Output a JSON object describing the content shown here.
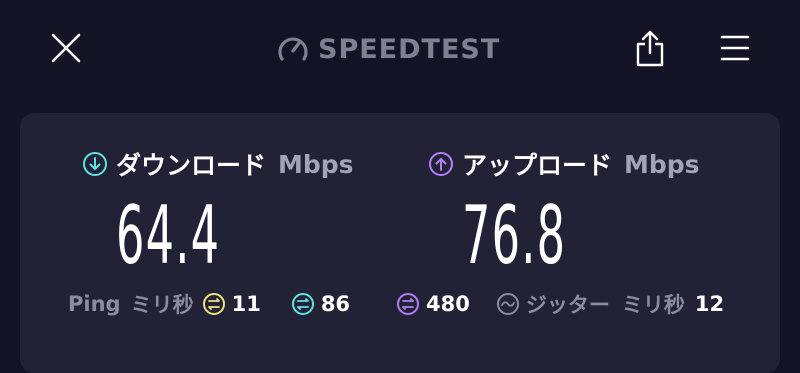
{
  "header": {
    "logo_text": "SPEEDTEST",
    "close_icon": "close-icon",
    "share_icon": "share-icon",
    "menu_icon": "menu-icon"
  },
  "download": {
    "label": "ダウンロード",
    "unit": "Mbps",
    "value": "64.4",
    "icon": "download-arrow-icon",
    "color": "#5fe3df"
  },
  "upload": {
    "label": "アップロード",
    "unit": "Mbps",
    "value": "76.8",
    "icon": "upload-arrow-icon",
    "color": "#b57ef8"
  },
  "latency": {
    "ping_label": "Ping",
    "ping_unit": "ミリ秒",
    "idle_value": "11",
    "idle_color": "#f4e07c",
    "download_value": "86",
    "download_color": "#5fe3df",
    "upload_value": "480",
    "upload_color": "#b57ef8",
    "jitter_label": "ジッター",
    "jitter_unit": "ミリ秒",
    "jitter_value": "12"
  },
  "colors": {
    "background": "#131325",
    "panel": "#222236",
    "muted": "#8c8ca0"
  }
}
